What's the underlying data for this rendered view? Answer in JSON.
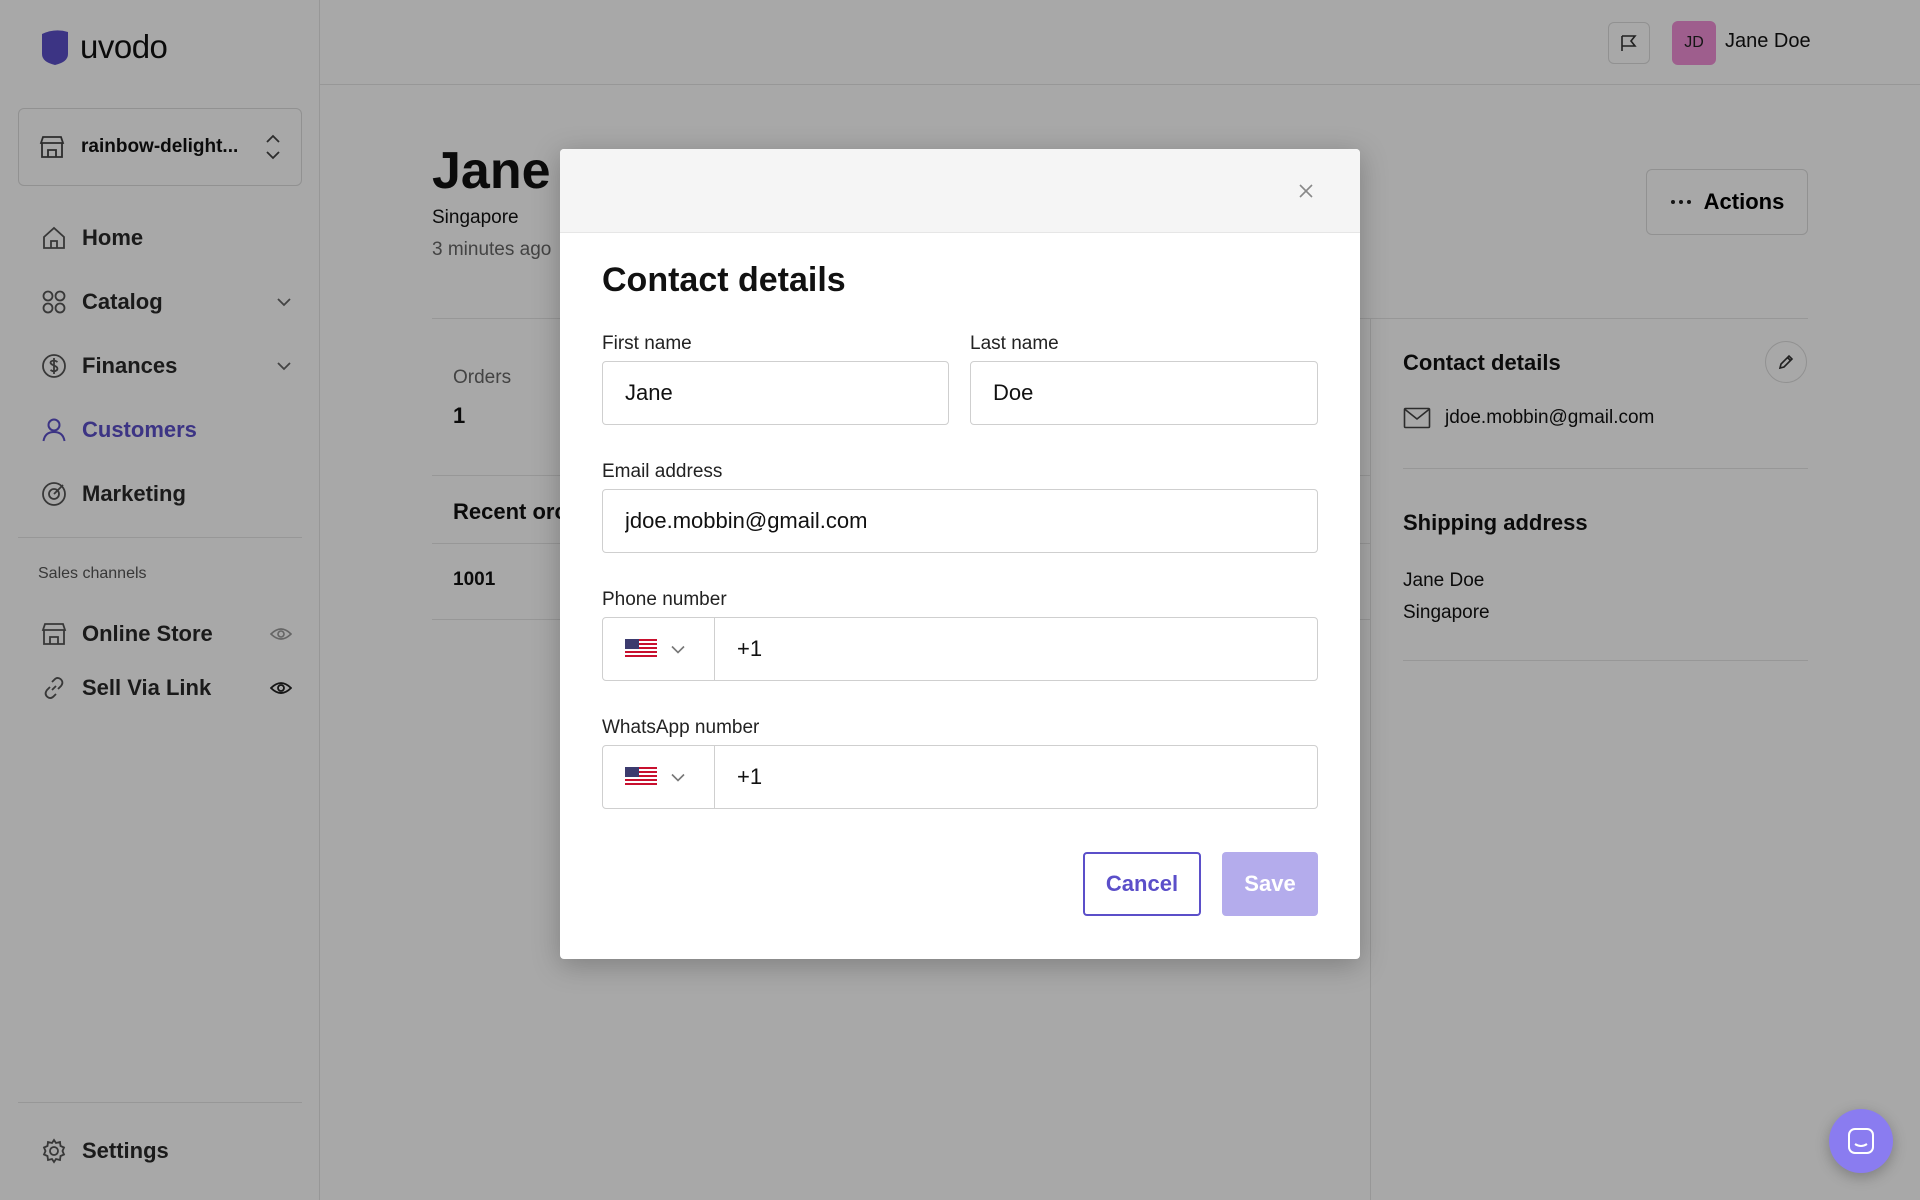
{
  "brand": {
    "name": "uvodo",
    "color": "#5b4fc9"
  },
  "store_switcher": {
    "name": "rainbow-delight..."
  },
  "nav": {
    "home": "Home",
    "catalog": "Catalog",
    "finances": "Finances",
    "customers": "Customers",
    "marketing": "Marketing",
    "sales_channels_label": "Sales channels",
    "online_store": "Online Store",
    "sell_via_link": "Sell Via Link",
    "settings": "Settings"
  },
  "topbar": {
    "avatar_initials": "JD",
    "user_name": "Jane Doe"
  },
  "customer": {
    "name": "Jane",
    "location": "Singapore",
    "updated": "3 minutes ago",
    "actions_label": "Actions",
    "orders_label": "Orders",
    "orders_count": "1",
    "recent_orders_label": "Recent orc",
    "recent_order_number": "1001"
  },
  "right_panel": {
    "contact_title": "Contact details",
    "email": "jdoe.mobbin@gmail.com",
    "shipping_title": "Shipping address",
    "shipping_name": "Jane Doe",
    "shipping_city": "Singapore"
  },
  "modal": {
    "title": "Contact details",
    "first_name_label": "First name",
    "first_name_value": "Jane",
    "last_name_label": "Last name",
    "last_name_value": "Doe",
    "email_label": "Email address",
    "email_value": "jdoe.mobbin@gmail.com",
    "phone_label": "Phone number",
    "phone_value": "+1",
    "whatsapp_label": "WhatsApp number",
    "whatsapp_value": "+1",
    "cancel_label": "Cancel",
    "save_label": "Save"
  },
  "icons": {
    "logo": "shield-logo-icon",
    "store": "storefront-icon",
    "home": "home-icon",
    "catalog": "grid-icon",
    "finances": "dollar-icon",
    "customers": "user-icon",
    "marketing": "target-icon",
    "online_store": "storefront-icon",
    "sell_via_link": "link-icon",
    "visibility": "eye-icon",
    "settings": "gear-icon",
    "flag": "flag-icon",
    "close": "close-icon",
    "edit": "pencil-icon",
    "mail": "mail-icon",
    "country": "us-flag-icon",
    "chat": "chat-icon"
  }
}
